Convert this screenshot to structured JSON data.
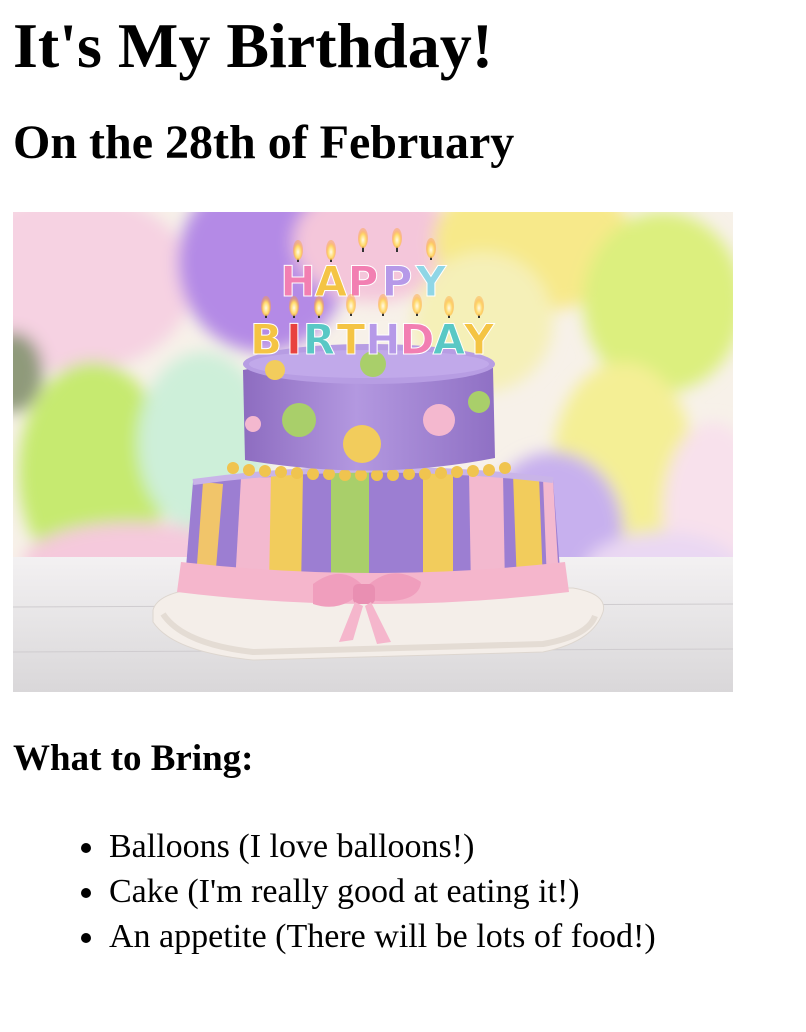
{
  "page": {
    "title": "It's My Birthday!",
    "date_heading": "On the 28th of February",
    "hero_image": {
      "alt": "Two-tier birthday cake with Happy Birthday candles",
      "candle_line_1": "HAPPY",
      "candle_line_2": "BIRTHDAY"
    },
    "bring_heading": "What to Bring:",
    "bring_items": [
      "Balloons (I love balloons!)",
      "Cake (I'm really good at eating it!)",
      "An appetite (There will be lots of food!)"
    ]
  },
  "colors": {
    "text": "#000000",
    "background": "#ffffff",
    "cake_purple": "#a98bd6",
    "cake_pink": "#f4b8cf",
    "cake_yellow": "#f2cc5c",
    "cake_green": "#a9cf6a"
  }
}
